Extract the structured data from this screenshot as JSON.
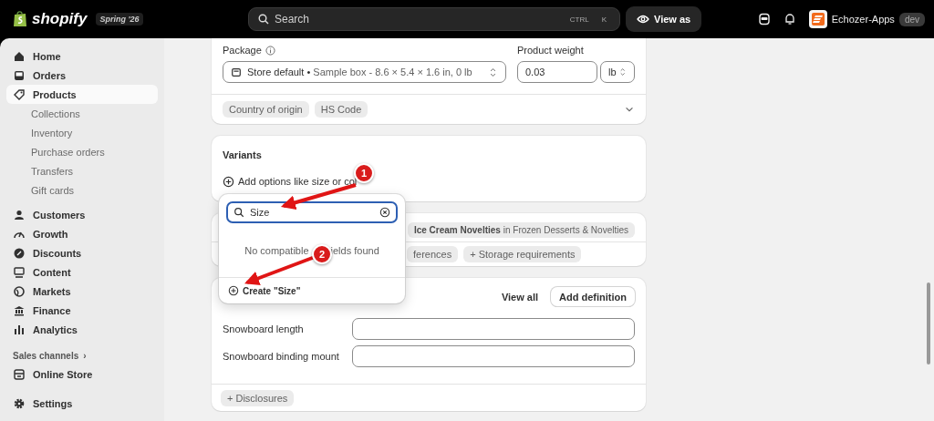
{
  "topbar": {
    "brand": "shopify",
    "edition": "Spring '26",
    "search": {
      "placeholder": "Search",
      "keys": [
        "CTRL",
        "K"
      ]
    },
    "view_as": "View as",
    "store": {
      "name": "Echozer-Apps",
      "badge": "dev"
    }
  },
  "sidebar": {
    "items": [
      {
        "label": "Home",
        "selected": false
      },
      {
        "label": "Orders",
        "selected": false
      },
      {
        "label": "Products",
        "selected": true,
        "children": [
          {
            "label": "Collections",
            "selected": false
          },
          {
            "label": "Inventory",
            "selected": false
          },
          {
            "label": "Purchase orders",
            "selected": false
          },
          {
            "label": "Transfers",
            "selected": false
          },
          {
            "label": "Gift cards",
            "selected": false
          }
        ]
      },
      {
        "label": "Customers",
        "selected": false
      },
      {
        "label": "Growth",
        "selected": false
      },
      {
        "label": "Discounts",
        "selected": false
      },
      {
        "label": "Content",
        "selected": false
      },
      {
        "label": "Markets",
        "selected": false
      },
      {
        "label": "Finance",
        "selected": false
      },
      {
        "label": "Analytics",
        "selected": false
      }
    ],
    "section": "Sales channels",
    "section_more": "›",
    "channels": [
      {
        "label": "Online Store",
        "selected": false
      }
    ],
    "settings": {
      "label": "Settings",
      "selected": false
    }
  },
  "shipping": {
    "package_label": "Package",
    "package": {
      "name": "Store default",
      "separator": "•",
      "detail": "Sample box - 8.6 × 5.4 × 1.6 in, 0 lb"
    },
    "weight_label": "Product weight",
    "weight": "0.03",
    "unit": "lb",
    "chips": [
      "Country of origin",
      "HS Code"
    ]
  },
  "variants": {
    "title": "Variants",
    "add": "Add options like size or col"
  },
  "category": {
    "name": "Ice Cream Novelties",
    "path": "in Frozen Desserts & Novelties",
    "chips": [
      "ferences",
      "+ Storage requirements"
    ]
  },
  "metafields": {
    "view_all": "View all",
    "add": "Add definition",
    "fields": [
      {
        "label": "Snowboard length"
      },
      {
        "label": "Snowboard binding mount"
      }
    ],
    "chip": "+ Disclosures"
  },
  "popover": {
    "search": {
      "value": "Size"
    },
    "empty": [
      "No compatible",
      "ields found"
    ],
    "create": "Create \"Size\""
  },
  "annotations": [
    {
      "label": "1"
    },
    {
      "label": "2"
    }
  ]
}
